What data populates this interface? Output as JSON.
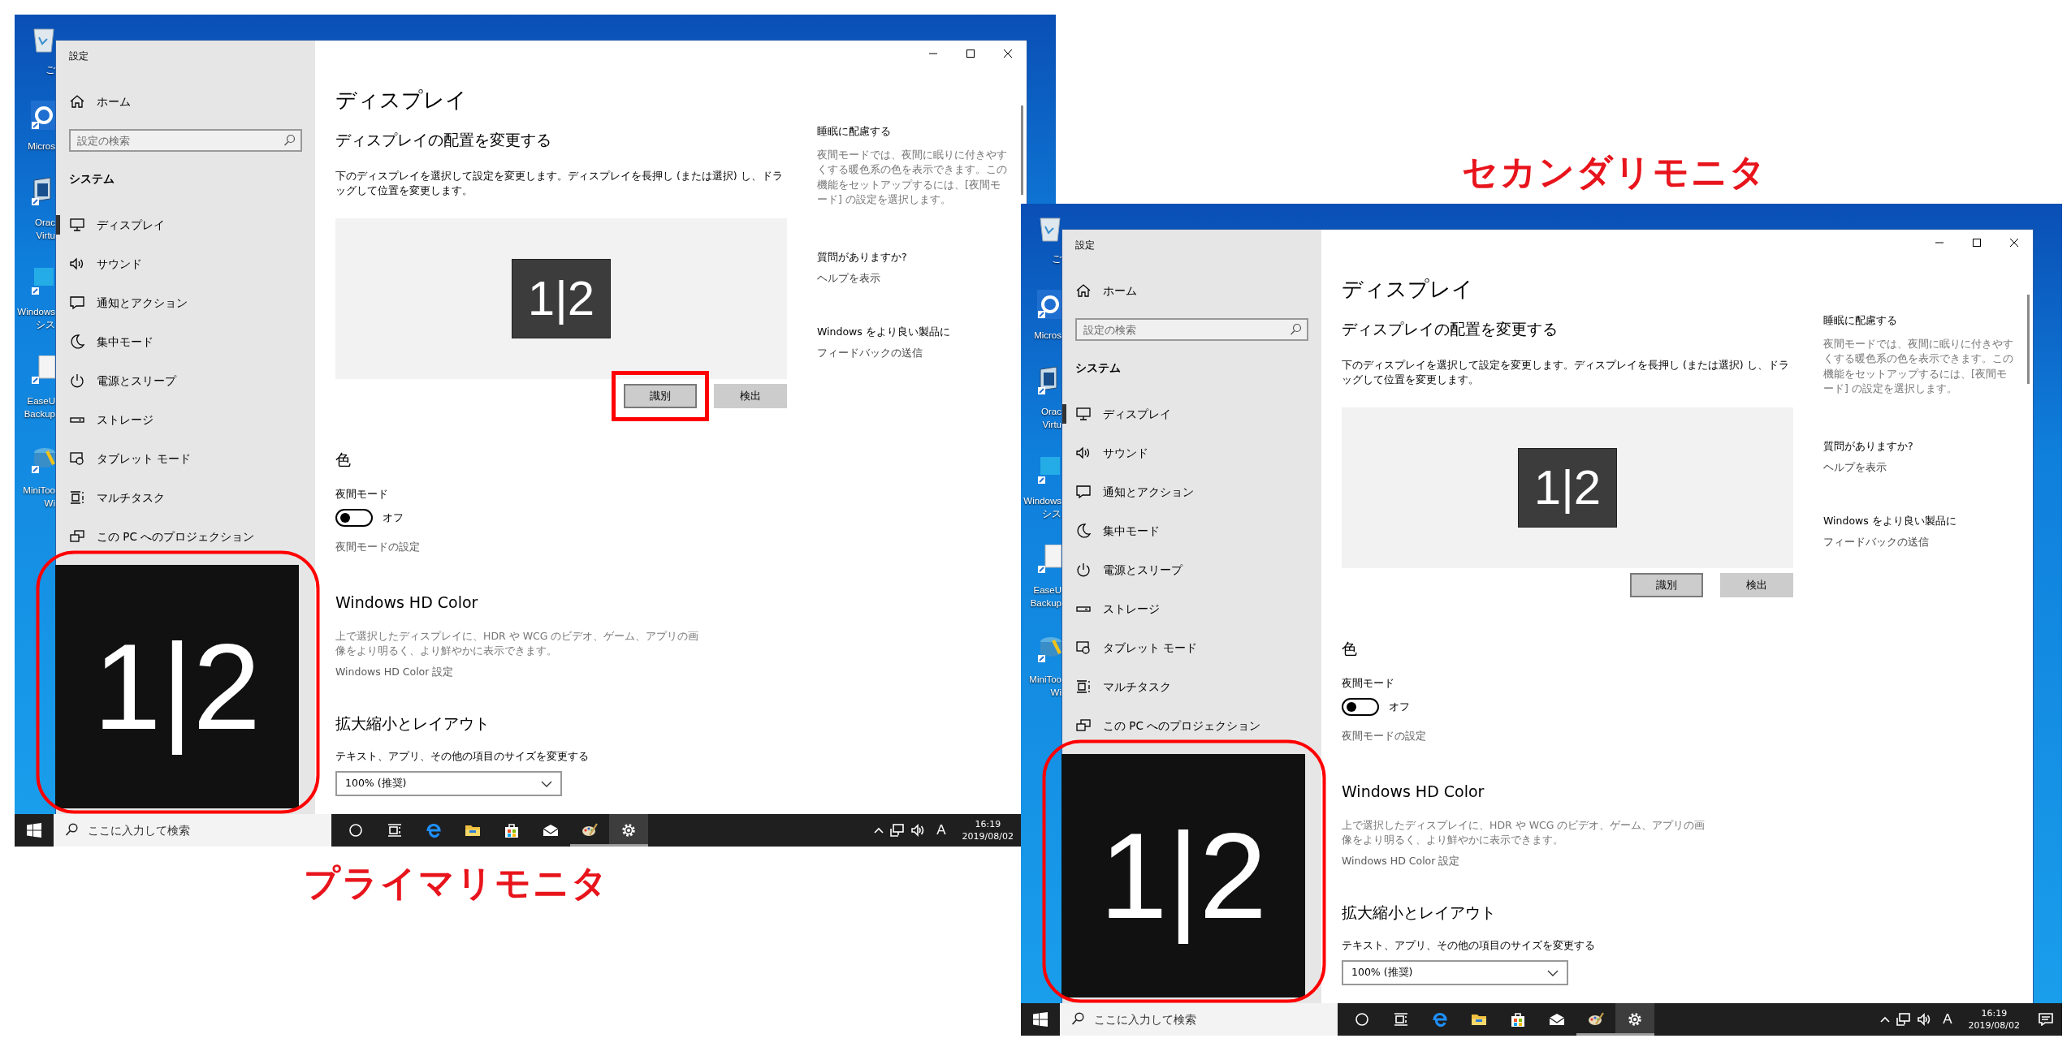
{
  "screens": [
    {
      "caption": "プライマリモニタ",
      "desktop_icons": [
        {
          "kind": "recycle-bin",
          "label": [
            "ご"
          ]
        },
        {
          "kind": "browser",
          "label": [
            "Micros"
          ]
        },
        {
          "kind": "computer",
          "label": [
            "Orac",
            "Virtu"
          ]
        },
        {
          "kind": "app",
          "label": [
            "Windows",
            "シス"
          ]
        },
        {
          "kind": "document",
          "label": [
            "EaseU",
            "Backup"
          ]
        },
        {
          "kind": "disk",
          "label": [
            "MiniToo",
            "Wi"
          ]
        }
      ],
      "window": {
        "title": "設定",
        "home": "ホーム",
        "search": {
          "placeholder": "設定の検索"
        },
        "section": "システム",
        "nav": [
          {
            "kind": "display",
            "label": "ディスプレイ",
            "selected": true
          },
          {
            "kind": "sound",
            "label": "サウンド",
            "selected": false
          },
          {
            "kind": "notification",
            "label": "通知とアクション",
            "selected": false
          },
          {
            "kind": "focus",
            "label": "集中モード",
            "selected": false
          },
          {
            "kind": "power",
            "label": "電源とスリープ",
            "selected": false
          },
          {
            "kind": "storage",
            "label": "ストレージ",
            "selected": false
          },
          {
            "kind": "tablet",
            "label": "タブレット モード",
            "selected": false
          },
          {
            "kind": "multitask",
            "label": "マルチタスク",
            "selected": false
          },
          {
            "kind": "project",
            "label": "この PC へのプロジェクション",
            "selected": false
          }
        ],
        "page_title": "ディスプレイ",
        "arrange_heading": "ディスプレイの配置を変更する",
        "arrange_desc": "下のディスプレイを選択して設定を変更します。ディスプレイを長押し (または選択) し、ドラッグして位置を変更します。",
        "monitor_tile": "1|2",
        "buttons": [
          {
            "label": "識別",
            "highlighted": true
          },
          {
            "label": "検出",
            "highlighted": false
          }
        ],
        "color_heading": "色",
        "night_label": "夜間モード",
        "night_toggle": {
          "on": false,
          "text": "オフ"
        },
        "night_link": "夜間モードの設定",
        "hd_heading": "Windows HD Color",
        "hd_desc": "上で選択したディスプレイに、HDR や WCG のビデオ、ゲーム、アプリの画像をより明るく、より鮮やかに表示できます。",
        "hd_link": "Windows HD Color 設定",
        "scale_heading": "拡大縮小とレイアウト",
        "scale_label": "テキスト、アプリ、その他の項目のサイズを変更する",
        "scale_value": "100% (推奨)",
        "tips": [
          {
            "heading": "睡眠に配慮する",
            "text": "夜間モードでは、夜間に眠りに付きやすくする暖色系の色を表示できます。この機能をセットアップするには、[夜間モード] の設定を選択します。"
          },
          {
            "heading": "質問がありますか?",
            "link": "ヘルプを表示"
          },
          {
            "heading": "Windows をより良い製品に",
            "link": "フィードバックの送信"
          }
        ]
      },
      "identify_overlay": {
        "text": "1|2",
        "circled": true
      },
      "taskbar": {
        "search": {
          "placeholder": "ここに入力して検索"
        },
        "apps": [
          {
            "kind": "cortana",
            "running": false,
            "active": false
          },
          {
            "kind": "task-view",
            "running": false,
            "active": false
          },
          {
            "kind": "edge",
            "running": false,
            "active": false
          },
          {
            "kind": "explorer",
            "running": false,
            "active": false
          },
          {
            "kind": "store",
            "running": false,
            "active": false
          },
          {
            "kind": "mail",
            "running": false,
            "active": false
          },
          {
            "kind": "paint",
            "running": true,
            "active": false
          },
          {
            "kind": "settings",
            "running": true,
            "active": true
          }
        ],
        "ime": "A",
        "time": "16:19",
        "date": "2019/08/02",
        "notification_button": false
      }
    },
    {
      "caption": "セカンダリモニタ",
      "desktop_icons": [
        {
          "kind": "recycle-bin",
          "label": [
            "ご"
          ]
        },
        {
          "kind": "browser",
          "label": [
            "Micros"
          ]
        },
        {
          "kind": "computer",
          "label": [
            "Orac",
            "Virtu"
          ]
        },
        {
          "kind": "app",
          "label": [
            "Windows",
            "シス"
          ]
        },
        {
          "kind": "document",
          "label": [
            "EaseU",
            "Backup"
          ]
        },
        {
          "kind": "disk",
          "label": [
            "MiniToo",
            "Wi"
          ]
        }
      ],
      "window": {
        "title": "設定",
        "home": "ホーム",
        "search": {
          "placeholder": "設定の検索"
        },
        "section": "システム",
        "nav": [
          {
            "kind": "display",
            "label": "ディスプレイ",
            "selected": true
          },
          {
            "kind": "sound",
            "label": "サウンド",
            "selected": false
          },
          {
            "kind": "notification",
            "label": "通知とアクション",
            "selected": false
          },
          {
            "kind": "focus",
            "label": "集中モード",
            "selected": false
          },
          {
            "kind": "power",
            "label": "電源とスリープ",
            "selected": false
          },
          {
            "kind": "storage",
            "label": "ストレージ",
            "selected": false
          },
          {
            "kind": "tablet",
            "label": "タブレット モード",
            "selected": false
          },
          {
            "kind": "multitask",
            "label": "マルチタスク",
            "selected": false
          },
          {
            "kind": "project",
            "label": "この PC へのプロジェクション",
            "selected": false
          }
        ],
        "page_title": "ディスプレイ",
        "arrange_heading": "ディスプレイの配置を変更する",
        "arrange_desc": "下のディスプレイを選択して設定を変更します。ディスプレイを長押し (または選択) し、ドラッグして位置を変更します。",
        "monitor_tile": "1|2",
        "buttons": [
          {
            "label": "識別",
            "highlighted": false
          },
          {
            "label": "検出",
            "highlighted": false
          }
        ],
        "color_heading": "色",
        "night_label": "夜間モード",
        "night_toggle": {
          "on": false,
          "text": "オフ"
        },
        "night_link": "夜間モードの設定",
        "hd_heading": "Windows HD Color",
        "hd_desc": "上で選択したディスプレイに、HDR や WCG のビデオ、ゲーム、アプリの画像をより明るく、より鮮やかに表示できます。",
        "hd_link": "Windows HD Color 設定",
        "scale_heading": "拡大縮小とレイアウト",
        "scale_label": "テキスト、アプリ、その他の項目のサイズを変更する",
        "scale_value": "100% (推奨)",
        "tips": [
          {
            "heading": "睡眠に配慮する",
            "text": "夜間モードでは、夜間に眠りに付きやすくする暖色系の色を表示できます。この機能をセットアップするには、[夜間モード] の設定を選択します。"
          },
          {
            "heading": "質問がありますか?",
            "link": "ヘルプを表示"
          },
          {
            "heading": "Windows をより良い製品に",
            "link": "フィードバックの送信"
          }
        ]
      },
      "identify_overlay": {
        "text": "1|2",
        "circled": true
      },
      "taskbar": {
        "search": {
          "placeholder": "ここに入力して検索"
        },
        "apps": [
          {
            "kind": "cortana",
            "running": false,
            "active": false
          },
          {
            "kind": "task-view",
            "running": false,
            "active": false
          },
          {
            "kind": "edge",
            "running": false,
            "active": false
          },
          {
            "kind": "explorer",
            "running": false,
            "active": false
          },
          {
            "kind": "store",
            "running": false,
            "active": false
          },
          {
            "kind": "mail",
            "running": false,
            "active": false
          },
          {
            "kind": "paint",
            "running": true,
            "active": false
          },
          {
            "kind": "settings",
            "running": true,
            "active": true
          }
        ],
        "ime": "A",
        "time": "16:19",
        "date": "2019/08/02",
        "notification_button": true
      }
    }
  ]
}
